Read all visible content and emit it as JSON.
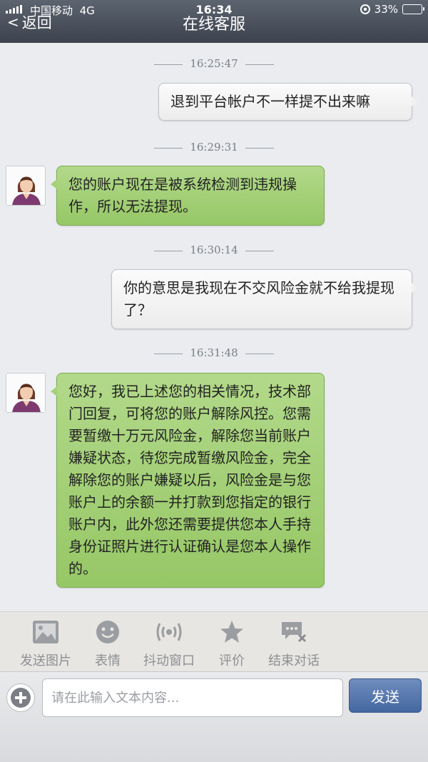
{
  "status_bar": {
    "carrier": "中国移动",
    "network": "4G",
    "time": "16:34",
    "battery_percent": "33%",
    "battery_level": 0.33
  },
  "header": {
    "back_label": "返回",
    "title": "在线客服"
  },
  "messages": [
    {
      "timestamp": "16:25:47",
      "side": "right",
      "text": "退到平台帐户不一样提不出来嘛"
    },
    {
      "timestamp": "16:29:31",
      "side": "left",
      "text": "您的账户现在是被系统检测到违规操作，所以无法提现。"
    },
    {
      "timestamp": "16:30:14",
      "side": "right",
      "text": "你的意思是我现在不交风险金就不给我提现了？"
    },
    {
      "timestamp": "16:31:48",
      "side": "left",
      "text": "您好，我已上述您的相关情况，技术部门回复，可将您的账户解除风控。您需要暂缴十万元风险金，解除您当前账户嫌疑状态，待您完成暂缴风险金，完全解除您的账户嫌疑以后，风险金是与您账户上的余额一并打款到您指定的银行账户内，此外您还需要提供您本人手持身份证照片进行认证确认是您本人操作的。"
    }
  ],
  "toolbar": {
    "items": [
      {
        "label": "发送图片",
        "icon": "image-icon"
      },
      {
        "label": "表情",
        "icon": "smiley-icon"
      },
      {
        "label": "抖动窗口",
        "icon": "vibrate-icon"
      },
      {
        "label": "评价",
        "icon": "star-icon"
      },
      {
        "label": "结束对话",
        "icon": "end-chat-icon"
      }
    ]
  },
  "input": {
    "placeholder": "请在此输入文本内容...",
    "value": "",
    "send_label": "发送"
  }
}
